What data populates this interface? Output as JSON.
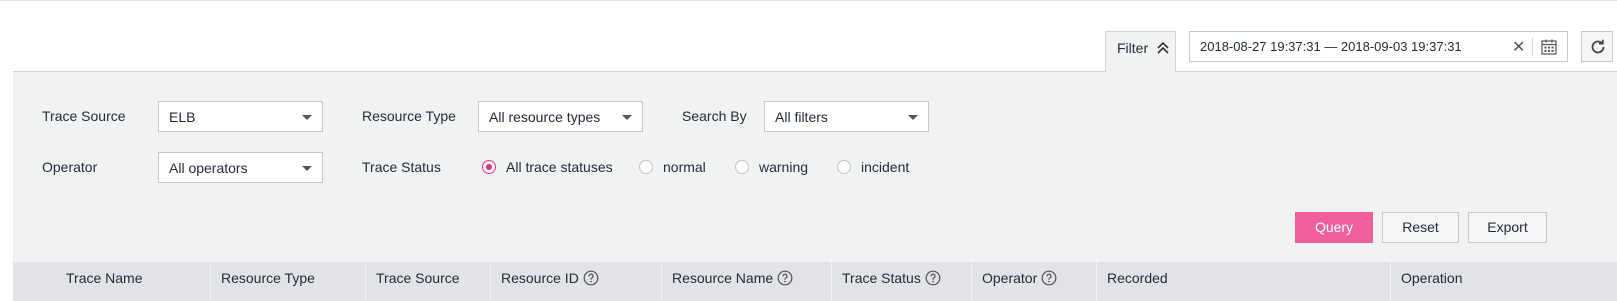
{
  "toolbar": {
    "filter_label": "Filter",
    "date_range": "2018-08-27 19:37:31 — 2018-09-03 19:37:31"
  },
  "filters": {
    "trace_source": {
      "label": "Trace Source",
      "value": "ELB"
    },
    "resource_type": {
      "label": "Resource Type",
      "value": "All resource types"
    },
    "search_by": {
      "label": "Search By",
      "value": "All filters"
    },
    "operator": {
      "label": "Operator",
      "value": "All operators"
    },
    "trace_status": {
      "label": "Trace Status",
      "options": [
        "All trace statuses",
        "normal",
        "warning",
        "incident"
      ],
      "selected": "All trace statuses"
    }
  },
  "actions": {
    "query": "Query",
    "reset": "Reset",
    "export": "Export"
  },
  "table": {
    "columns": [
      "Trace Name",
      "Resource Type",
      "Trace Source",
      "Resource ID",
      "Resource Name",
      "Trace Status",
      "Operator",
      "Recorded",
      "Operation"
    ]
  },
  "colors": {
    "accent": "#e3317f",
    "primary_button": "#f0609e",
    "panel_bg": "#f1f2f2",
    "header_bg": "#e1e3e6"
  },
  "icons": [
    "chevron-double-up-icon",
    "clear-icon",
    "calendar-icon",
    "refresh-icon",
    "help-icon",
    "caret-down-icon"
  ]
}
